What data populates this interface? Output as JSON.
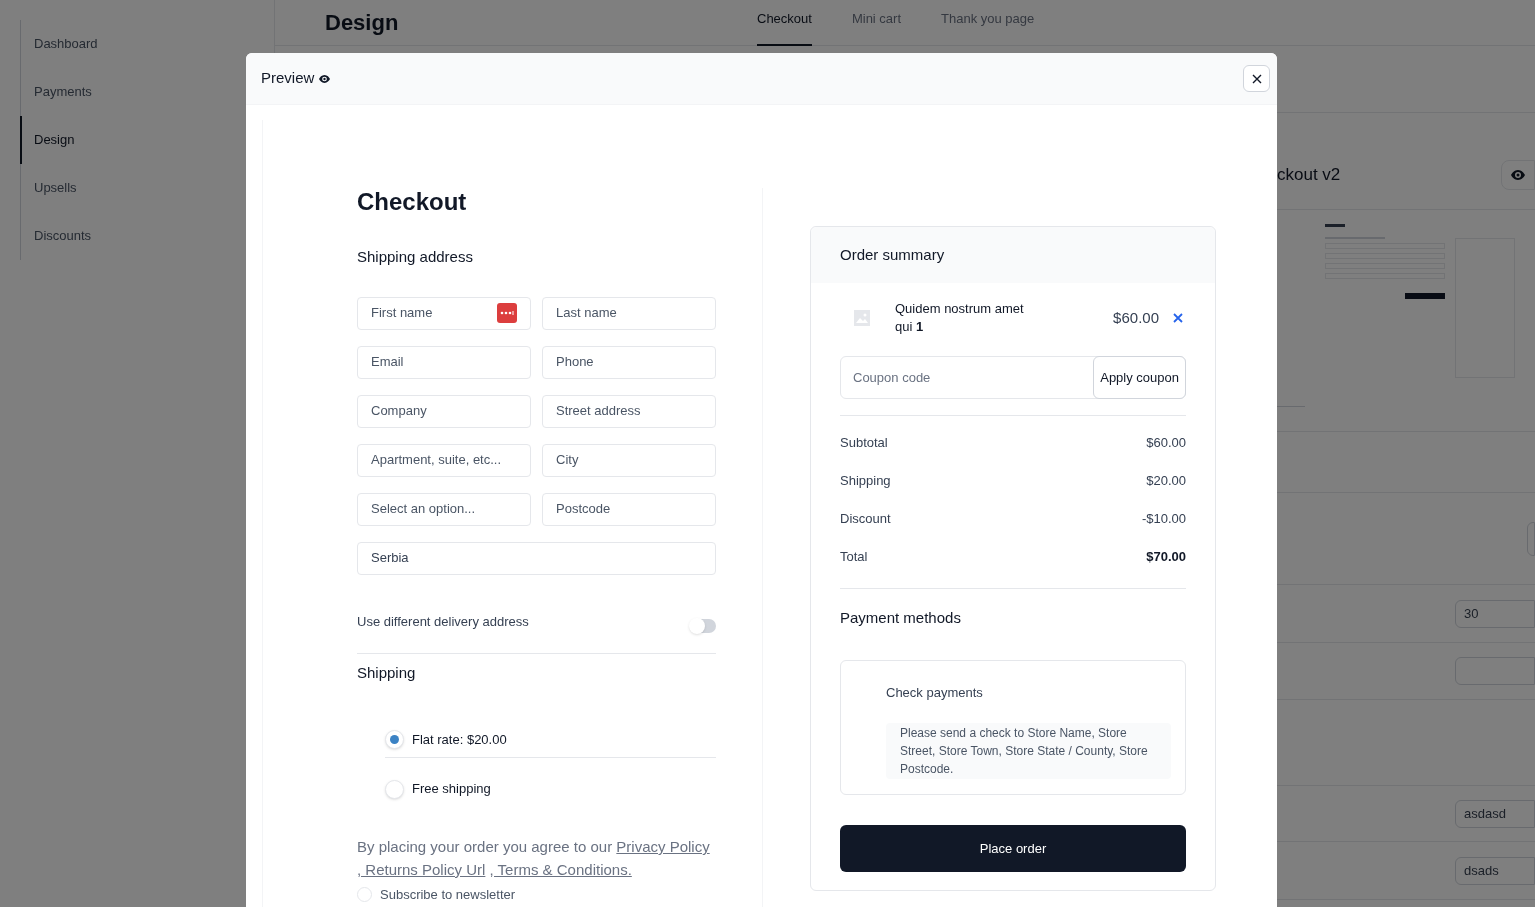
{
  "sidebar": {
    "items": [
      {
        "label": "Dashboard",
        "selected": false
      },
      {
        "label": "Payments",
        "selected": false
      },
      {
        "label": "Design",
        "selected": true
      },
      {
        "label": "Upsells",
        "selected": false
      },
      {
        "label": "Discounts",
        "selected": false
      }
    ]
  },
  "header": {
    "title": "Design",
    "tabs": [
      {
        "label": "Checkout",
        "selected": true
      },
      {
        "label": "Mini cart",
        "selected": false
      },
      {
        "label": "Thank you page",
        "selected": false
      }
    ]
  },
  "background_panel": {
    "title": "ckout v2",
    "fields": [
      {
        "value": "30"
      },
      {
        "value": "asdasd"
      },
      {
        "value": "dsads"
      }
    ]
  },
  "modal": {
    "title": "Preview",
    "checkout": {
      "title": "Checkout",
      "shipping_address_title": "Shipping address",
      "fields": [
        {
          "placeholder": "First name",
          "autofill_icon": true
        },
        {
          "placeholder": "Last name"
        },
        {
          "placeholder": "Email"
        },
        {
          "placeholder": "Phone"
        },
        {
          "placeholder": "Company"
        },
        {
          "placeholder": "Street address"
        },
        {
          "placeholder": "Apartment, suite, etc..."
        },
        {
          "placeholder": "City"
        },
        {
          "placeholder": "Select an option..."
        },
        {
          "placeholder": "Postcode"
        },
        {
          "value": "Serbia",
          "wide": true
        }
      ],
      "delivery_toggle": {
        "label": "Use different delivery address",
        "on": false
      },
      "shipping": {
        "title": "Shipping",
        "options": [
          {
            "label": "Flat rate: $20.00",
            "selected": true
          },
          {
            "label": "Free shipping",
            "selected": false
          }
        ]
      },
      "terms": {
        "text": "By placing your order you agree to our",
        "links": [
          "Privacy Policy",
          ", Returns Policy Url",
          ", Terms & Conditions."
        ]
      },
      "newsletter": {
        "label": "Subscribe to newsletter",
        "checked": false
      }
    },
    "order_summary": {
      "title": "Order summary",
      "items": [
        {
          "name": "Quidem nostrum amet qui",
          "quantity": "1",
          "price": "$60.00"
        }
      ],
      "coupon": {
        "placeholder": "Coupon code",
        "button": "Apply coupon"
      },
      "totals": [
        {
          "kind": "line",
          "label": "Subtotal",
          "value": "$60.00"
        },
        {
          "kind": "line",
          "label": "Shipping",
          "value": "$20.00"
        },
        {
          "kind": "line",
          "label": "Discount",
          "value": "-$10.00"
        },
        {
          "kind": "total",
          "label": "Total",
          "value": "$70.00"
        }
      ],
      "payment_title": "Payment methods",
      "payment_methods": [
        {
          "name": "Check payments",
          "description": "Please send a check to Store Name, Store Street, Store Town, Store State / County, Store Postcode."
        }
      ],
      "place_order": "Place order"
    }
  }
}
